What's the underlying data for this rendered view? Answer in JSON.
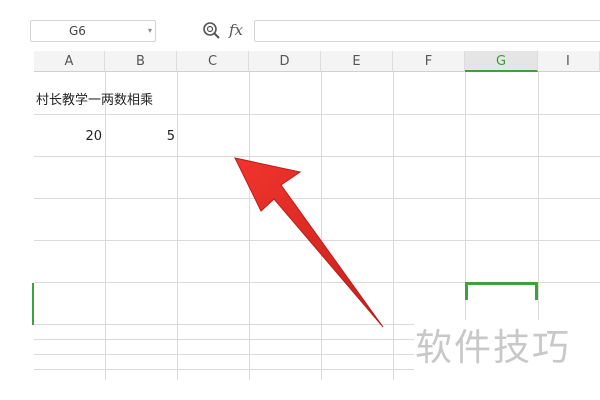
{
  "formula_bar": {
    "cell_ref": "G6",
    "dropdown_glyph": "▾",
    "fx_label": "fx",
    "formula_value": ""
  },
  "columns": [
    "A",
    "B",
    "C",
    "D",
    "E",
    "F",
    "G",
    "I"
  ],
  "selected_column": "G",
  "cells": {
    "A1": "村长教学一两数相乘",
    "A2": "20",
    "B2": "5"
  },
  "colors": {
    "selection": "#3ea13e",
    "arrow": "#e0201c",
    "watermark": "#c8c8c8"
  },
  "watermark": "软件技巧"
}
